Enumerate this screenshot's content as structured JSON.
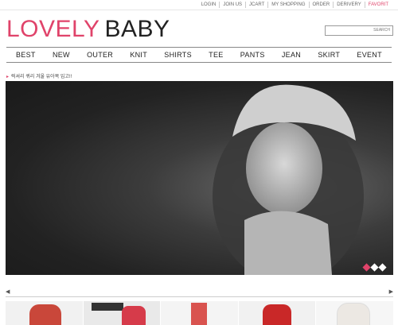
{
  "top_links": [
    "LOGIN",
    "JOIN US",
    "JCART",
    "MY SHOPPING",
    "ORDER",
    "DERIVERY",
    "FAVORIT"
  ],
  "logo": {
    "part1": "LOVELY",
    "part2": "BABY"
  },
  "search": {
    "label": "SEARCH"
  },
  "nav": [
    "BEST",
    "NEW",
    "OUTER",
    "KNIT",
    "SHIRTS",
    "TEE",
    "PANTS",
    "JEAN",
    "SKIRT",
    "EVENT"
  ],
  "notice": "럭셔리 퀴리 겨울 유아복 입고!!",
  "hero": {
    "slides": 3,
    "active_slide": 1
  },
  "scroller": {
    "left": "◀",
    "right": "▶"
  },
  "colors": {
    "accent": "#e0436a"
  }
}
